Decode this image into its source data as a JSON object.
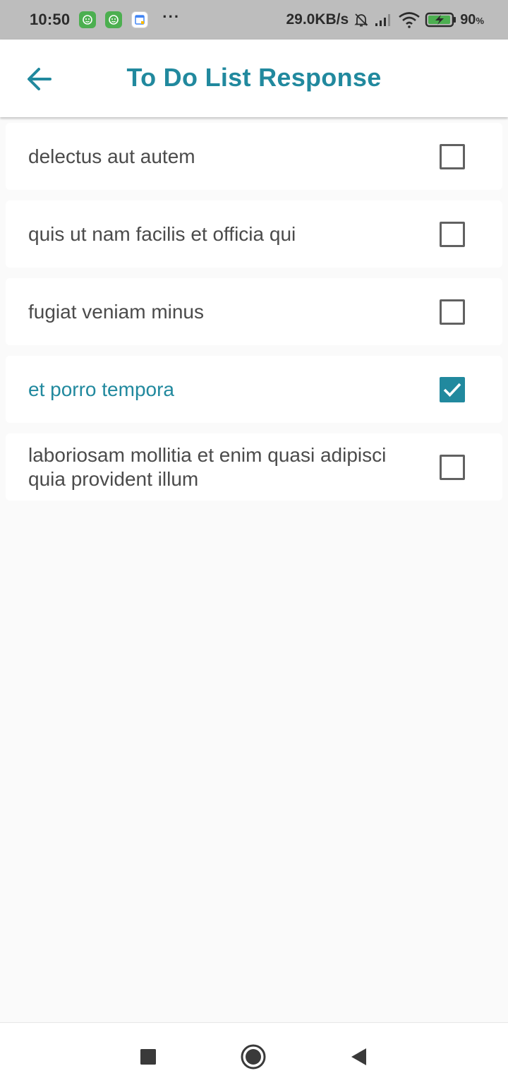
{
  "status_bar": {
    "time": "10:50",
    "network_speed": "29.0KB/s",
    "battery_percent": "90",
    "battery_unit": "%",
    "icons": [
      "app-icon",
      "app-icon",
      "calendar-icon",
      "more-icon",
      "bell-muted-icon",
      "signal-icon",
      "wifi-icon",
      "battery-charging-icon"
    ]
  },
  "header": {
    "title": "To Do List Response",
    "back_icon": "arrow-left-icon"
  },
  "todos": [
    {
      "title": "delectus aut autem",
      "completed": false
    },
    {
      "title": "quis ut nam facilis et officia qui",
      "completed": false
    },
    {
      "title": "fugiat veniam minus",
      "completed": false
    },
    {
      "title": "et porro tempora",
      "completed": true
    },
    {
      "title": "laboriosam mollitia et enim quasi adipisci quia provident illum",
      "completed": false
    }
  ],
  "nav_bar": {
    "icons": [
      "recents-square-icon",
      "home-circle-icon",
      "back-triangle-icon"
    ]
  },
  "colors": {
    "accent": "#21899e",
    "text": "#4b4b4b",
    "background": "#fafafa",
    "status_bar": "#bdbdbd"
  }
}
